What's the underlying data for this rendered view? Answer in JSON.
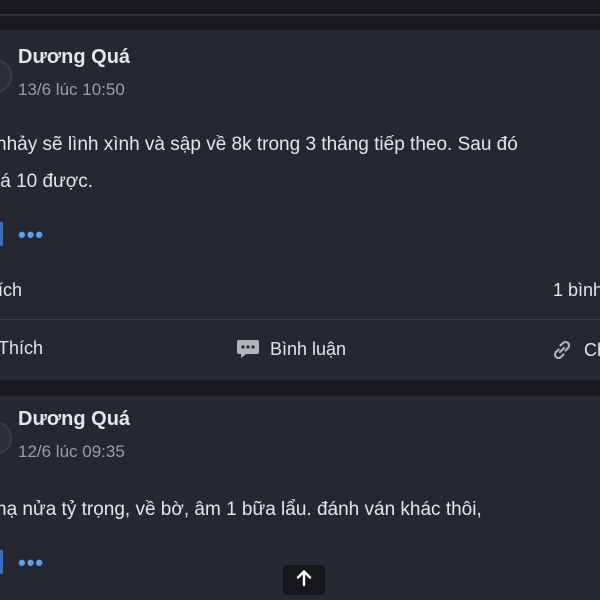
{
  "posts": [
    {
      "author": "Dương Quá",
      "time": "13/6 lúc 10:50",
      "text_line1": "nhảy sẽ lình xình và sập về 8k trong 3 tháng tiếp theo. Sau đó",
      "text_line2": "iá 10 được.",
      "more": "•••",
      "stats_left": "ích",
      "stats_right": "1 bình",
      "actions": {
        "like": "Thích",
        "comment": "Bình luận",
        "share": "Ch"
      }
    },
    {
      "author": "Dương Quá",
      "time": "12/6 lúc 09:35",
      "text_line1": "hạ nửa tỷ trọng, về bờ, âm 1 bữa lẩu. đánh ván khác thôi,",
      "more": "•••"
    }
  ],
  "icons": {
    "comment": "comment-icon",
    "share": "link-icon",
    "scroll": "arrow-up-icon"
  },
  "colors": {
    "background": "#17191d",
    "card": "#252830",
    "accent": "#5e9ef2",
    "muted": "#9a9ea6"
  }
}
